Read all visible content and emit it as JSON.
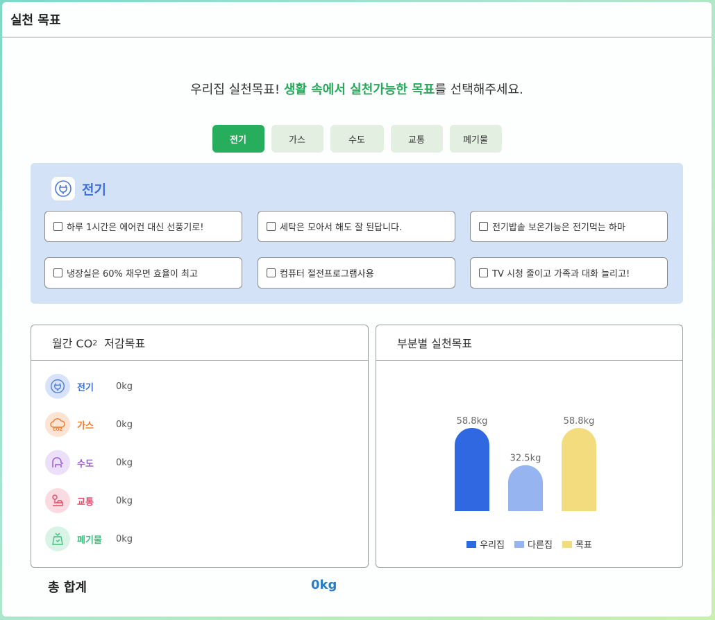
{
  "header": {
    "title": "실천 목표"
  },
  "intro": {
    "prefix": "우리집 실천목표! ",
    "highlight": "생활 속에서 실천가능한 목표",
    "suffix": "를 선택해주세요."
  },
  "tabs": [
    {
      "label": "전기",
      "active": true
    },
    {
      "label": "가스",
      "active": false
    },
    {
      "label": "수도",
      "active": false
    },
    {
      "label": "교통",
      "active": false
    },
    {
      "label": "폐기물",
      "active": false
    }
  ],
  "category": {
    "title": "전기",
    "icon": "plug-icon",
    "options": [
      "하루 1시간은 에어컨 대신 선풍기로!",
      "세탁은 모아서 해도 잘 된답니다.",
      "전기밥솥 보온기능은 전기먹는 하마",
      "냉장실은 60% 채우면 효율이 최고",
      "컴퓨터 절전프로그램사용",
      "TV 시청 줄이고 가족과 대화 늘리고!"
    ]
  },
  "monthly": {
    "title_prefix": "월간 CO",
    "title_sub": "2",
    "title_suffix": "저감목표",
    "rows": [
      {
        "name": "전기",
        "value": "0kg",
        "icon": "plug-icon",
        "color": "#3c6fd1",
        "bg": "#d6e3fa"
      },
      {
        "name": "가스",
        "value": "0kg",
        "icon": "co2-cloud-icon",
        "color": "#ef7a2b",
        "bg": "#fde3d2"
      },
      {
        "name": "수도",
        "value": "0kg",
        "icon": "faucet-icon",
        "color": "#9b5ad6",
        "bg": "#ecdff9"
      },
      {
        "name": "교통",
        "value": "0kg",
        "icon": "car-icon",
        "color": "#e34a6a",
        "bg": "#fbdbe2"
      },
      {
        "name": "폐기물",
        "value": "0kg",
        "icon": "waste-bag-icon",
        "color": "#3fbf7f",
        "bg": "#d9f4e6"
      }
    ]
  },
  "total": {
    "label": "총 합계",
    "value": "0kg"
  },
  "chart_panel": {
    "title": "부분별 실천목표"
  },
  "chart_data": {
    "type": "bar",
    "categories": [
      "우리집",
      "다른집",
      "목표"
    ],
    "values": [
      58.8,
      32.5,
      58.8
    ],
    "value_labels": [
      "58.8kg",
      "32.5kg",
      "58.8kg"
    ],
    "colors": [
      "#2f68e0",
      "#95b4f0",
      "#f3dc7e"
    ],
    "legend": [
      "우리집",
      "다른집",
      "목표"
    ],
    "legend_position": "bottom",
    "title": "",
    "xlabel": "",
    "ylabel": "",
    "grid": false
  }
}
